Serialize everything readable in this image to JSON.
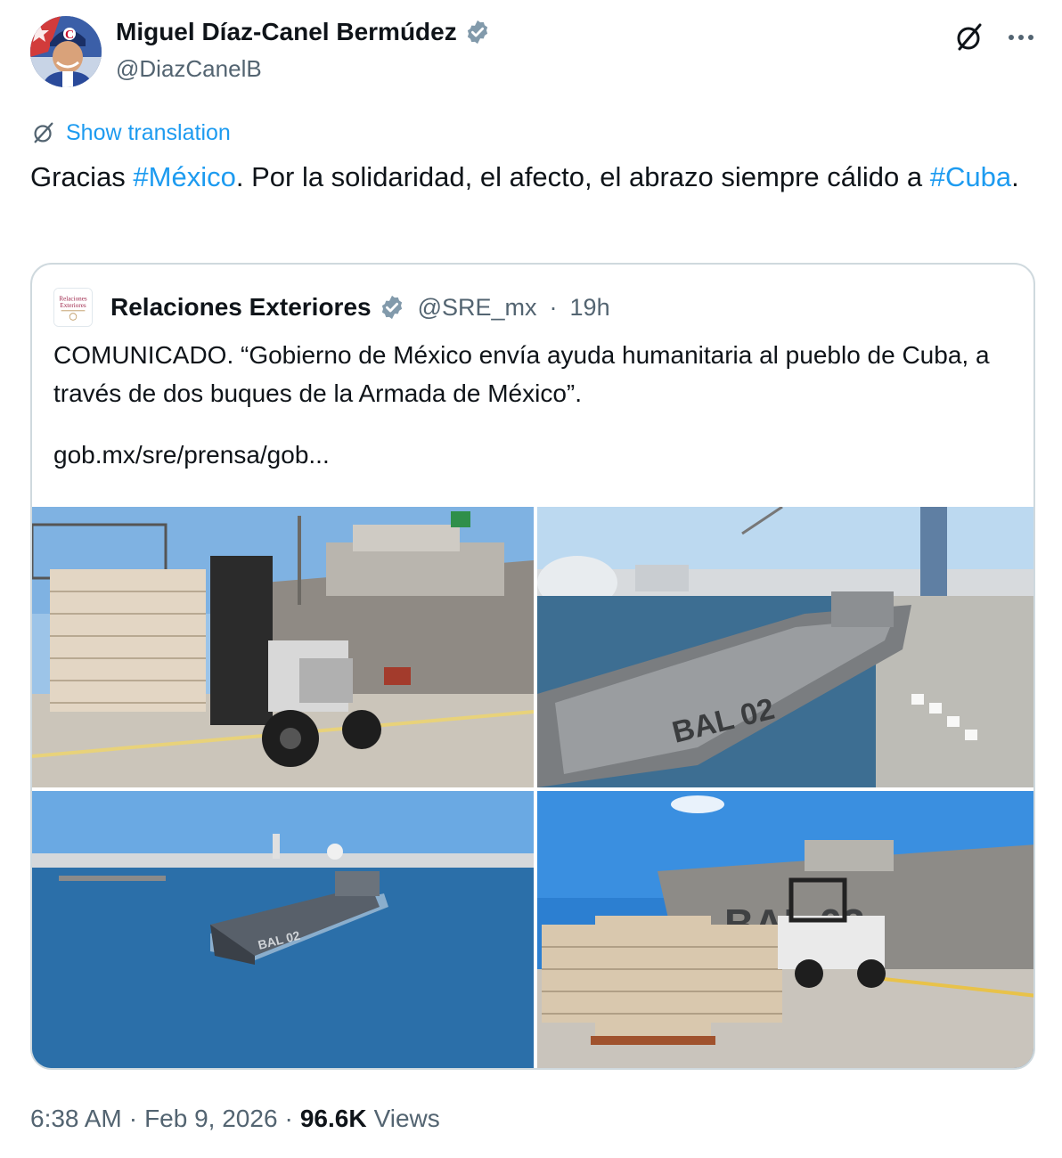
{
  "author": {
    "name": "Miguel Díaz-Canel Bermúdez",
    "handle": "@DiazCanelB",
    "verified": true,
    "avatar_letter": "C"
  },
  "header_actions": {
    "grok_icon": "grok-slash-icon",
    "more_icon": "more-horizontal-icon"
  },
  "translation": {
    "label": "Show translation",
    "icon": "grok-slash-icon"
  },
  "tweet": {
    "text_1": "Gracias ",
    "hashtag_1": "#México",
    "text_2": ". Por la solidaridad,  el afecto, el abrazo siempre cálido a ",
    "hashtag_2": "#Cuba",
    "text_3": "."
  },
  "quote": {
    "avatar_text_1": "Relaciones",
    "avatar_text_2": "Exteriores",
    "name": "Relaciones Exteriores",
    "verified": true,
    "handle": "@SRE_mx",
    "separator": "·",
    "time": "19h",
    "text": "COMUNICADO. “Gobierno de México envía ayuda humanitaria al pueblo de Cuba, a través de dos buques de la Armada de México”.",
    "link": "gob.mx/sre/prensa/gob...",
    "photos": [
      {
        "description": "forklift-with-pallet-at-ship"
      },
      {
        "description": "ship-bal02-docked-at-port"
      },
      {
        "description": "ship-bal02-at-sea"
      },
      {
        "description": "pallets-and-forklift-at-ship"
      }
    ],
    "photo_labels": [
      "BAL 02",
      "BAL 02",
      "BAL 02"
    ]
  },
  "meta": {
    "time": "6:38 AM",
    "sep1": "·",
    "date": "Feb 9, 2026",
    "sep2": "·",
    "views_count": "96.6K",
    "views_label": "Views"
  },
  "colors": {
    "link": "#1d9bf0",
    "text": "#0f1419",
    "secondary": "#536471",
    "border": "#cfd9de",
    "verified": "#829aab"
  }
}
